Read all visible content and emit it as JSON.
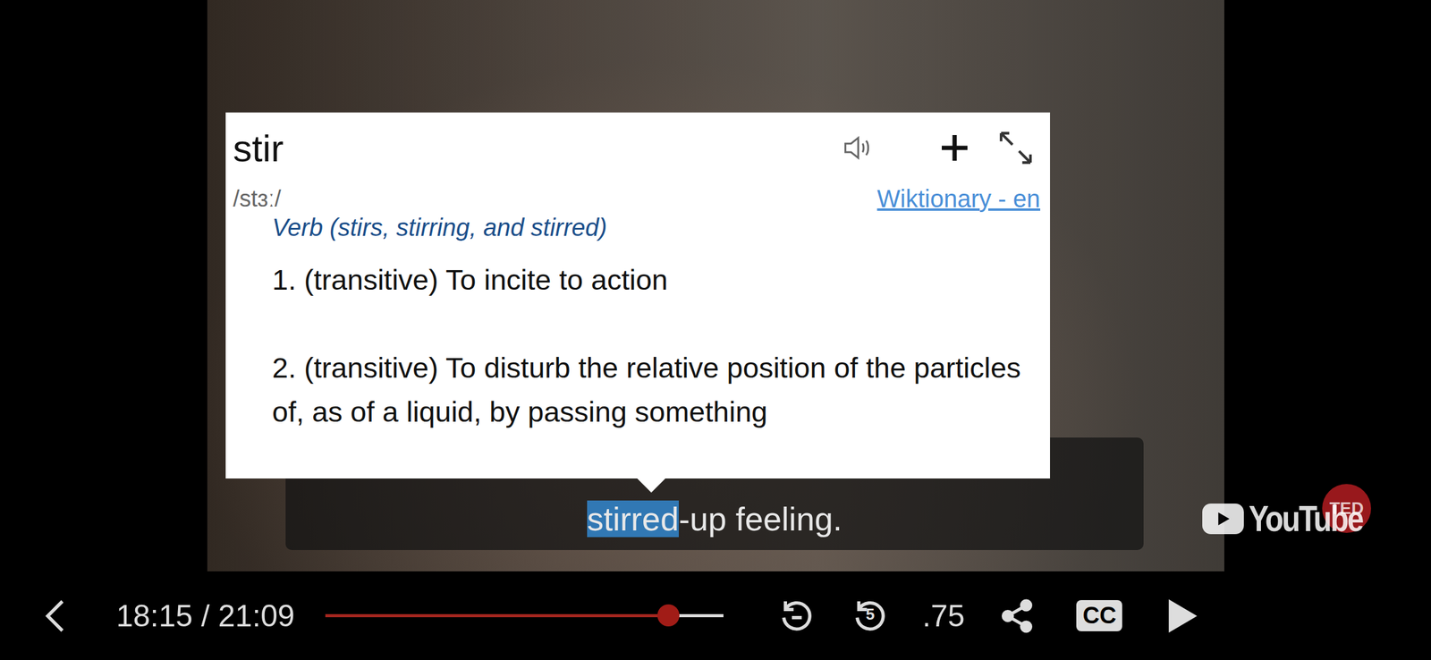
{
  "popup": {
    "word": "stir",
    "pronunciation": "/stɜː/",
    "source": "Wiktionary - en",
    "part_of_speech": "Verb (stirs, stirring, and stirred)",
    "definitions": [
      "1. (transitive) To incite to action",
      "2. (transitive) To disturb the relative position of the particles of, as of a liquid, by passing something"
    ]
  },
  "subtitle": {
    "highlighted": "stirred",
    "rest": "-up feeling."
  },
  "badges": {
    "ted": "TED",
    "youtube": "YouTube"
  },
  "player": {
    "time": "18:15 / 21:09",
    "progress": {
      "level": 0.862
    },
    "rewind_seconds": "5",
    "speed": ".75",
    "captions": "CC"
  }
}
